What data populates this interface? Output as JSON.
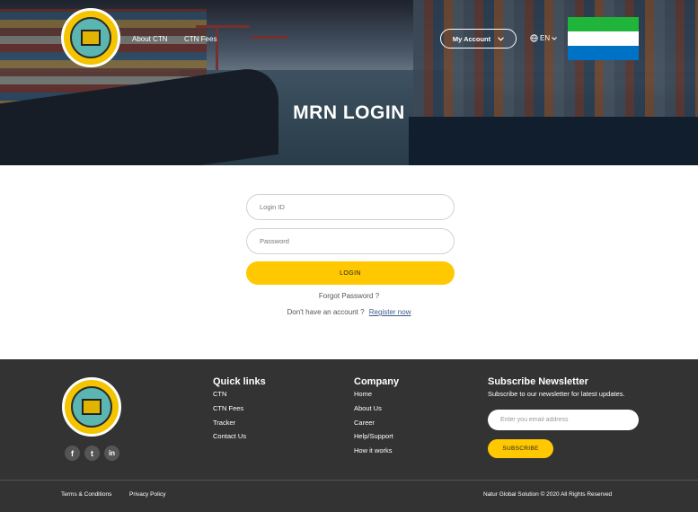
{
  "header": {
    "nav": [
      "About CTN",
      "CTN Fees"
    ],
    "account_label": "My Account",
    "language": "EN",
    "title": "MRN LOGIN"
  },
  "login": {
    "login_id_placeholder": "Login ID",
    "password_placeholder": "Password",
    "login_button": "LOGIN",
    "forgot_password": "Forgot Password ?",
    "no_account_text": "Don't have an account ?",
    "register_link": "Register now"
  },
  "footer": {
    "quick_links": {
      "title": "Quick links",
      "items": [
        "CTN",
        "CTN Fees",
        "Tracker",
        "Contact Us"
      ]
    },
    "company": {
      "title": "Company",
      "items": [
        "Home",
        "About Us",
        "Career",
        "Help/Support",
        "How it works"
      ]
    },
    "newsletter": {
      "title": "Subscribe Newsletter",
      "subtitle": "Subscribe to our newsletter for latest updates.",
      "email_placeholder": "Enter you email address",
      "button": "SUBSCRIBE"
    },
    "social": [
      "f",
      "t",
      "in"
    ],
    "bottom_links": [
      "Terms & Conditions",
      "Privacy Policy"
    ],
    "copyright": "Natur Global Solution © 2020 All Rights Reserved"
  },
  "colors": {
    "accent_yellow": "#ffc800",
    "footer_bg": "#333333",
    "flag": [
      "#1eb53a",
      "#ffffff",
      "#0072c6"
    ]
  },
  "icons": {
    "chevron": "chevron-down-icon",
    "globe": "globe-icon",
    "facebook": "facebook-icon",
    "twitter": "twitter-icon",
    "linkedin": "linkedin-icon"
  }
}
